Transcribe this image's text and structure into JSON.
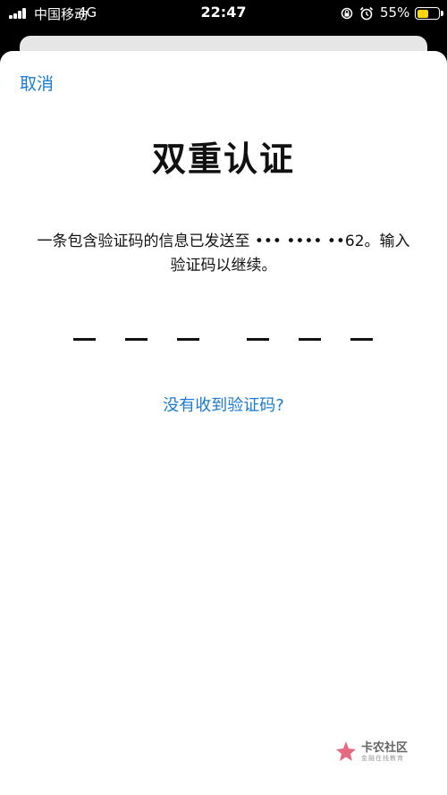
{
  "status_bar": {
    "carrier": "中国移动",
    "network": "4G",
    "time": "22:47",
    "battery_percent": "55%",
    "battery_level": 0.55,
    "icons": [
      "signal-icon",
      "lock-rotation-icon",
      "alarm-icon",
      "battery-icon"
    ]
  },
  "sheet": {
    "cancel_label": "取消",
    "title": "双重认证",
    "message": "一条包含验证码的信息已发送至 ••• •••• ••62。输入验证码以继续。",
    "code_length": 6,
    "resend_label": "没有收到验证码?"
  },
  "watermark": {
    "name": "卡农社区",
    "sub": "金融在线教育"
  },
  "colors": {
    "link": "#1a7bd0",
    "battery": "#ffd60a",
    "watermark_logo": "#e0506a"
  }
}
